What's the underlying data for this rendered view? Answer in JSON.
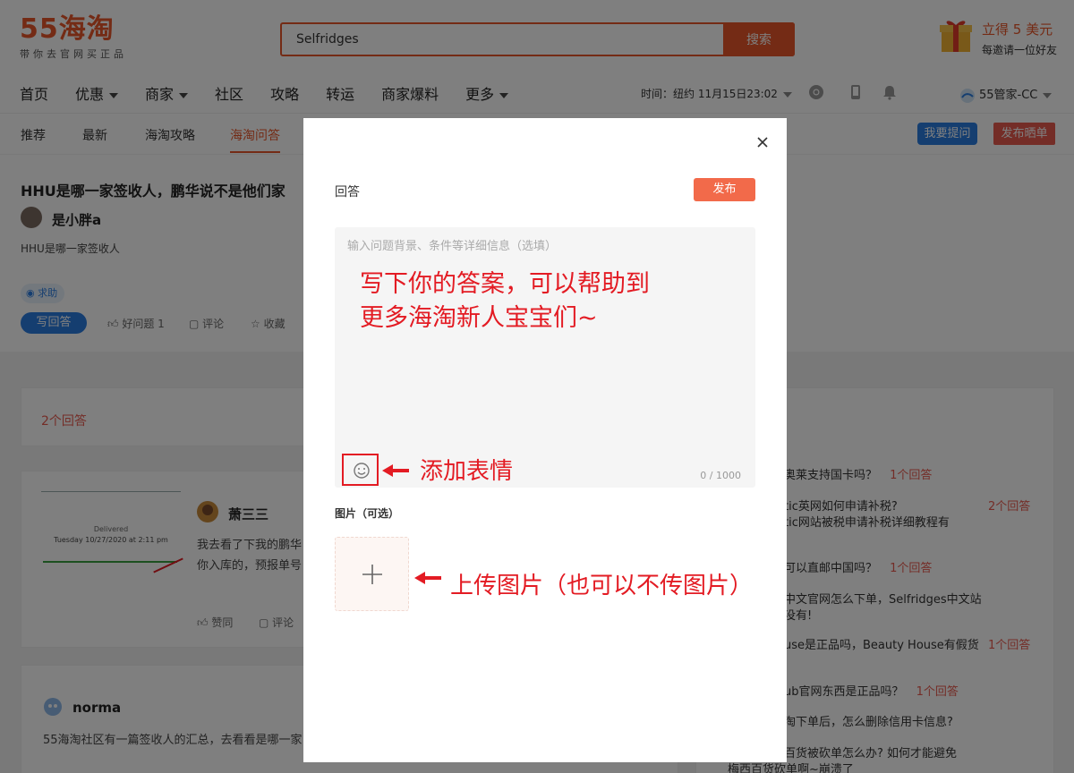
{
  "header": {
    "logo_main": "55海淘",
    "logo_sub": "带你去官网买正品",
    "search_value": "Selfridges",
    "search_button": "搜索",
    "promo_title": "立得 5 美元",
    "promo_sub": "每邀请一位好友",
    "nav": [
      "首页",
      "优惠",
      "商家",
      "社区",
      "攻略",
      "转运",
      "商家爆料",
      "更多"
    ],
    "time": "时间：纽约 11月15日23:02",
    "user": "55管家-CC"
  },
  "subnav": {
    "items": [
      "推荐",
      "最新",
      "海淘攻略",
      "海淘问答"
    ],
    "ask_button": "我要提问",
    "post_button": "发布晒单"
  },
  "question": {
    "title": "HHU是哪一家签收人，鹏华说不是他们家",
    "author": "是小胖a",
    "desc": "HHU是哪一家签收人",
    "tag": "求助",
    "answer_button": "写回答",
    "like": "好问题 1",
    "comment": "评论",
    "collect": "收藏"
  },
  "answers": {
    "count": "2个回答",
    "a1_name": "萧三三",
    "a1_line1": "我去看了下我的鹏华",
    "a1_line2": "你入库的，预报单号",
    "a1_like": "赞同",
    "a1_comment": "评论",
    "a1_img_status": "Delivered",
    "a1_img_date": "Tuesday 10/27/2020 at 2:11 pm",
    "a2_name": "norma",
    "a2_text": "55海淘社区有一篇签收人的汇总，去看看是哪一家"
  },
  "sidebar": {
    "items": [
      {
        "text": "奥莱支持国卡吗？",
        "count": "1个回答"
      },
      {
        "text": "tic英网如何申请补税?",
        "count": "2个回答"
      },
      {
        "text": "tic网站被税申请补税详细教程有",
        "count": ""
      },
      {
        "text": "可以直邮中国吗？",
        "count": "1个回答"
      },
      {
        "text": "中文官网怎么下单，Selfridges中文站",
        "count": ""
      },
      {
        "text": "没有!",
        "count": ""
      },
      {
        "text": "use是正品吗，Beauty House有假货",
        "count": "1个回答"
      },
      {
        "text": "ub官网东西是正品吗？",
        "count": "1个回答"
      },
      {
        "text": "淘下单后，怎么删除信用卡信息?",
        "count": ""
      },
      {
        "text": "百货被砍单怎么办? 如何才能避免",
        "count": ""
      },
      {
        "text": "梅西百货砍单啊~崩溃了",
        "count": ""
      }
    ]
  },
  "modal": {
    "title": "回答",
    "publish": "发布",
    "placeholder": "输入问题背景、条件等详细信息（选填）",
    "note_line1": "写下你的答案，可以帮助到",
    "note_line2": "更多海淘新人宝宝们~",
    "emoji_note": "添加表情",
    "counter": "0 / 1000",
    "image_label": "图片（可选）",
    "upload_note": "上传图片（也可以不传图片）"
  }
}
